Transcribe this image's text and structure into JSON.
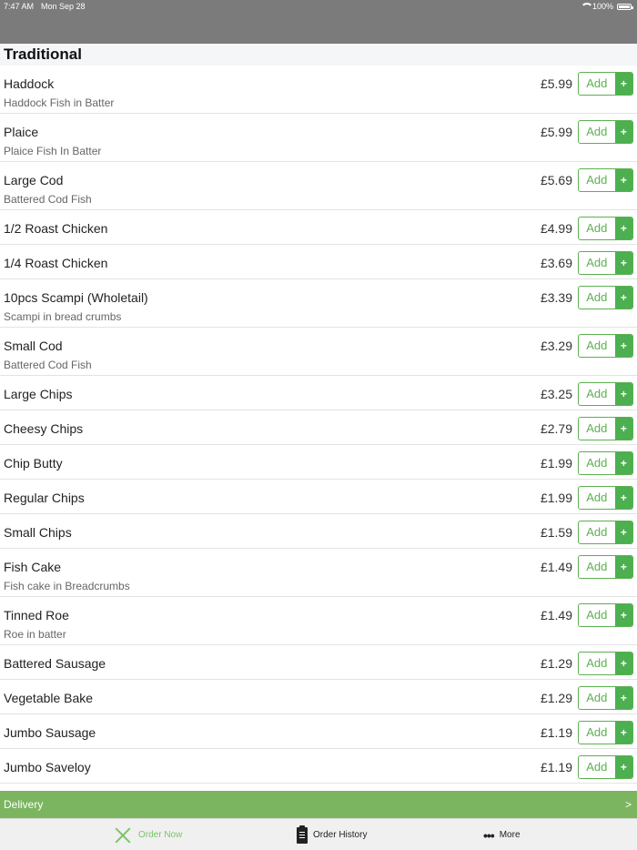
{
  "status": {
    "time": "7:47 AM",
    "date": "Mon Sep 28",
    "battery": "100%"
  },
  "section": {
    "title": "Traditional"
  },
  "add_label": "Add",
  "add_plus": "+",
  "items": [
    {
      "name": "Haddock",
      "desc": "Haddock Fish in Batter",
      "price": "£5.99"
    },
    {
      "name": "Plaice",
      "desc": "Plaice Fish In Batter",
      "price": "£5.99"
    },
    {
      "name": "Large Cod",
      "desc": "Battered Cod Fish",
      "price": "£5.69"
    },
    {
      "name": "1/2 Roast Chicken",
      "desc": "",
      "price": "£4.99"
    },
    {
      "name": "1/4 Roast Chicken",
      "desc": "",
      "price": "£3.69"
    },
    {
      "name": "10pcs Scampi (Wholetail)",
      "desc": "Scampi in bread crumbs",
      "price": "£3.39"
    },
    {
      "name": "Small Cod",
      "desc": "Battered Cod Fish",
      "price": "£3.29"
    },
    {
      "name": "Large Chips",
      "desc": "",
      "price": "£3.25"
    },
    {
      "name": "Cheesy Chips",
      "desc": "",
      "price": "£2.79"
    },
    {
      "name": "Chip Butty",
      "desc": "",
      "price": "£1.99"
    },
    {
      "name": "Regular Chips",
      "desc": "",
      "price": "£1.99"
    },
    {
      "name": "Small Chips",
      "desc": "",
      "price": "£1.59"
    },
    {
      "name": "Fish Cake",
      "desc": "Fish cake in Breadcrumbs",
      "price": "£1.49"
    },
    {
      "name": "Tinned Roe",
      "desc": "Roe in batter",
      "price": "£1.49"
    },
    {
      "name": "Battered Sausage",
      "desc": "",
      "price": "£1.29"
    },
    {
      "name": "Vegetable Bake",
      "desc": "",
      "price": "£1.29"
    },
    {
      "name": "Jumbo Sausage",
      "desc": "",
      "price": "£1.19"
    },
    {
      "name": "Jumbo Saveloy",
      "desc": "",
      "price": "£1.19"
    },
    {
      "name": "",
      "desc": "",
      "price": ""
    }
  ],
  "delivery": {
    "label": "Delivery",
    "chevron": ">"
  },
  "tabs": {
    "order_now": "Order Now",
    "order_history": "Order History",
    "more": "More"
  },
  "colors": {
    "accent": "#4caf50",
    "delivery_bar": "#7cb560",
    "status_bar": "#7b7b7b"
  },
  "icons": [
    "wifi-icon",
    "battery-icon",
    "utensils-icon",
    "clipboard-icon",
    "more-dots-icon"
  ]
}
